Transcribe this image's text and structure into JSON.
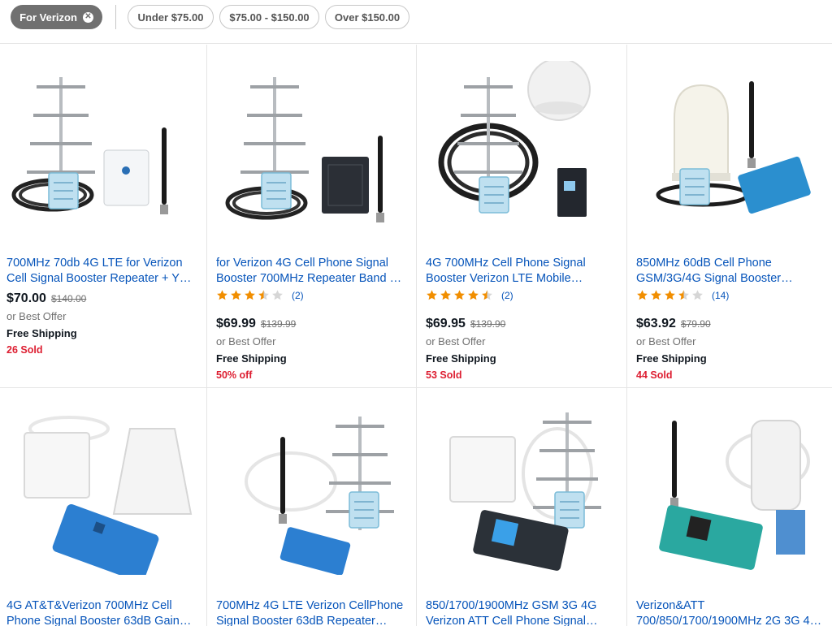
{
  "filters": {
    "active": "For Verizon",
    "options": [
      "Under $75.00",
      "$75.00 - $150.00",
      "Over $150.00"
    ]
  },
  "row1": [
    {
      "title": "700MHz 70db 4G LTE for Verizon Cell Signal Booster Repeater + Y…",
      "price": "$70.00",
      "was": "$140.00",
      "offer": "or Best Offer",
      "shipping": "Free Shipping",
      "badge": "26 Sold",
      "rating": null,
      "reviews": null,
      "image": "booster-kit-image"
    },
    {
      "title": "for Verizon 4G Cell Phone Signal Booster 700MHz Repeater Band …",
      "price": "$69.99",
      "was": "$139.99",
      "offer": "or Best Offer",
      "shipping": "Free Shipping",
      "badge": "50% off",
      "rating": 3.5,
      "reviews": "(2)",
      "image": "booster-kit-image"
    },
    {
      "title": "4G 700MHz Cell Phone Signal Booster Verizon LTE Mobile…",
      "price": "$69.95",
      "was": "$139.90",
      "offer": "or Best Offer",
      "shipping": "Free Shipping",
      "badge": "53 Sold",
      "rating": 4.5,
      "reviews": "(2)",
      "image": "booster-kit-image"
    },
    {
      "title": "850MHz 60dB Cell Phone GSM/3G/4G Signal Booster…",
      "price": "$63.92",
      "was": "$79.90",
      "offer": "or Best Offer",
      "shipping": "Free Shipping",
      "badge": "44 Sold",
      "rating": 3.5,
      "reviews": "(14)",
      "image": "booster-kit-image"
    }
  ],
  "row2": [
    {
      "title": "4G AT&T&Verizon 700MHz Cell Phone Signal Booster 63dB Gain…",
      "image": "booster-kit-image"
    },
    {
      "title": "700MHz 4G LTE Verizon CellPhone Signal Booster 63dB Repeater…",
      "image": "booster-kit-image"
    },
    {
      "title": "850/1700/1900MHz GSM 3G 4G Verizon ATT Cell Phone Signal…",
      "image": "booster-kit-image"
    },
    {
      "title": "Verizon&ATT 700/850/1700/1900MHz 2G 3G 4…",
      "image": "booster-kit-image"
    }
  ],
  "colors": {
    "link": "#0654ba",
    "sold": "#dd1e31",
    "star": "#f18e00",
    "chip_active": "#707070"
  }
}
